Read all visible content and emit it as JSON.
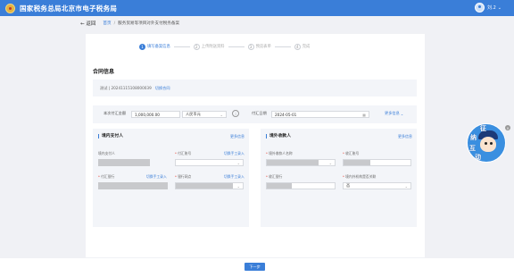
{
  "header": {
    "title": "国家税务总局北京市电子税务局",
    "user_name": "刘.2"
  },
  "breadcrumb": {
    "back_label": "返回",
    "home": "首页",
    "current": "服务贸易等项目对外支付税务备案"
  },
  "steps": [
    {
      "num": "1",
      "label": "填写备案信息"
    },
    {
      "num": "2",
      "label": "上传附送资料"
    },
    {
      "num": "3",
      "label": "预览表单"
    },
    {
      "num": "4",
      "label": "完成"
    }
  ],
  "section_title": "合同信息",
  "contract": {
    "text": "测试 | 20241115108000039",
    "link": "切换合同"
  },
  "amount": {
    "label": "本次付汇金额",
    "value": "1,000,000.00",
    "currency": "人民币元",
    "date_label": "付汇日期",
    "date_value": "2024-05-01",
    "more": "更多信息"
  },
  "domestic": {
    "title": "境内支付人",
    "more": "更多信息",
    "payer_label": "境内支付人",
    "account_label": "付汇账号",
    "account_action": "切换手工录入",
    "bank_label": "付汇银行",
    "bank_action": "切换手工录入",
    "outlet_label": "银行网点",
    "outlet_action": "切换手工录入"
  },
  "foreign": {
    "title": "境外收款人",
    "more": "更多信息",
    "name_label": "境外收款人名称",
    "account_label": "收汇账号",
    "bank_label": "收汇银行",
    "related_label": "境内外机构是否关联",
    "related_value": "否"
  },
  "footer": {
    "next_label": "下一步"
  },
  "mascot": {
    "chars": [
      "征",
      "纳",
      "互",
      "动"
    ]
  }
}
